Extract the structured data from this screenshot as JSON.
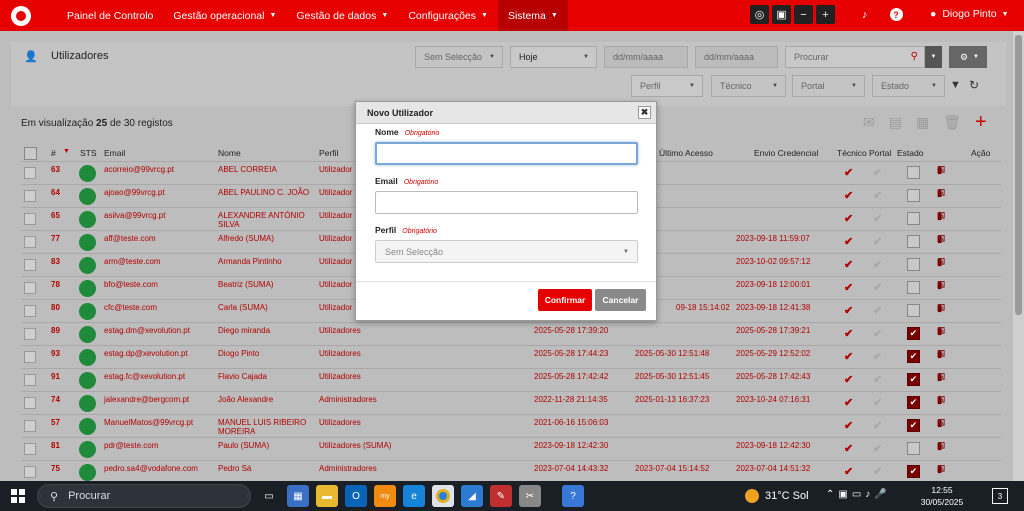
{
  "nav": {
    "items": [
      {
        "label": "Painel de Controlo",
        "caret": false,
        "active": false
      },
      {
        "label": "Gestão operacional",
        "caret": true,
        "active": false
      },
      {
        "label": "Gestão de dados",
        "caret": true,
        "active": false
      },
      {
        "label": "Configurações",
        "caret": true,
        "active": false
      },
      {
        "label": "Sistema",
        "caret": true,
        "active": true
      }
    ],
    "user": "Diogo Pinto",
    "tools": [
      "chat-icon",
      "contact-card-icon",
      "minus-icon",
      "plus-icon"
    ],
    "brand_color": "#e60000"
  },
  "header": {
    "title": "Utilizadores",
    "filters": {
      "selection": "Sem Selecção",
      "period": "Hoje",
      "date_from_placeholder": "dd/mm/aaaa",
      "date_to_placeholder": "dd/mm/aaaa",
      "search_placeholder": "Procurar",
      "profile": "Perfil",
      "technician": "Técnico",
      "portal": "Portal",
      "state": "Estado"
    }
  },
  "content": {
    "counter_prefix": "Em visualização",
    "counter_count": "25",
    "counter_suffix": "de 30 registos",
    "columns": {
      "num": "#",
      "sts": "STS",
      "email": "Email",
      "name": "Nome",
      "profile": "Perfil",
      "last_access": "Último Acesso",
      "credential": "Envio Credencial",
      "technician": "Técnico",
      "portal": "Portal",
      "state": "Estado",
      "action": "Ação"
    },
    "rows": [
      {
        "id": "63",
        "email": "acorreio@99vrcg.pt",
        "name": "ABEL CORREIA",
        "profile": "Utilizador",
        "created": "",
        "last": "",
        "cred": "",
        "tech": true,
        "portal": false,
        "state": false
      },
      {
        "id": "64",
        "email": "ajoao@99vrcg.pt",
        "name": "ABEL PAULINO C. JOÃO",
        "profile": "Utilizador",
        "created": "",
        "last": "",
        "cred": "",
        "tech": true,
        "portal": false,
        "state": false
      },
      {
        "id": "65",
        "email": "asilva@99vrcg.pt",
        "name": "ALEXANDRE ANTÓNIO",
        "name2": "SILVA",
        "profile": "Utilizador",
        "created": "",
        "last": "",
        "cred": "",
        "tech": true,
        "portal": false,
        "state": false
      },
      {
        "id": "77",
        "email": "aff@teste.com",
        "name": "Alfredo (SUMA)",
        "profile": "Utilizador",
        "created": "",
        "last": "",
        "cred": "2023-09-18 11:59:07",
        "tech": true,
        "portal": false,
        "state": false
      },
      {
        "id": "83",
        "email": "arm@teste.com",
        "name": "Armanda Pintinho",
        "profile": "Utilizador",
        "created": "",
        "last": "",
        "cred": "2023-10-02 09:57:12",
        "tech": true,
        "portal": false,
        "state": false
      },
      {
        "id": "78",
        "email": "bfo@teste.com",
        "name": "Beatriz (SUMA)",
        "profile": "Utilizador",
        "created": "",
        "last": "",
        "cred": "2023-09-18 12:00:01",
        "tech": true,
        "portal": false,
        "state": false
      },
      {
        "id": "80",
        "email": "cfc@teste.com",
        "name": "Carla (SUMA)",
        "profile": "Utilizador",
        "created": "",
        "last": "09-18 15:14:02",
        "cred": "2023-09-18 12:41:38",
        "tech": true,
        "portal": false,
        "state": false
      },
      {
        "id": "89",
        "email": "estag.dm@xevolution.pt",
        "name": "Diego miranda",
        "profile": "Utilizadores",
        "created": "2025-05-28 17:39:20",
        "last": "",
        "cred": "2025-05-28 17:39:21",
        "tech": true,
        "portal": false,
        "state": true
      },
      {
        "id": "93",
        "email": "estag.dp@xevolution.pt",
        "name": "Diogo Pinto",
        "profile": "Utilizadores",
        "created": "2025-05-28 17:44:23",
        "last": "2025-05-30 12:51:48",
        "cred": "2025-05-29 12:52:02",
        "tech": true,
        "portal": false,
        "state": true
      },
      {
        "id": "91",
        "email": "estag.fc@xevolution.pt",
        "name": "Flavio Cajada",
        "profile": "Utilizadores",
        "created": "2025-05-28 17:42:42",
        "last": "2025-05-30 12:51:45",
        "cred": "2025-05-28 17:42:43",
        "tech": true,
        "portal": false,
        "state": true
      },
      {
        "id": "74",
        "email": "jalexandre@bergcom.pt",
        "name": "João Alexandre",
        "profile": "Administradores",
        "created": "2022-11-28 21:14:35",
        "last": "2025-01-13 16:37:23",
        "cred": "2023-10-24 07:16:31",
        "tech": true,
        "portal": false,
        "state": true
      },
      {
        "id": "57",
        "email": "ManuelMatos@99vrcg.pt",
        "name": "MANUEL LUIS RIBEIRO",
        "name2": "MOREIRA",
        "profile": "Utilizadores",
        "created": "2021-06-16 15:06:03",
        "last": "",
        "cred": "",
        "tech": true,
        "portal": false,
        "state": true
      },
      {
        "id": "81",
        "email": "pdr@teste.com",
        "name": "Paulo (SUMA)",
        "profile": "Utilizadores (SUMA)",
        "created": "2023-09-18 12:42:30",
        "last": "",
        "cred": "2023-09-18 12:42:30",
        "tech": true,
        "portal": false,
        "state": false
      },
      {
        "id": "75",
        "email": "pedro.sa4@vodafone.com",
        "name": "Pedro Sá",
        "profile": "Administradores",
        "created": "2023-07-04 14:43:32",
        "last": "2023-07-04 15:14:52",
        "cred": "2023-07-04 14:51:32",
        "tech": true,
        "portal": false,
        "state": true
      }
    ]
  },
  "modal": {
    "title": "Novo Utilizador",
    "name_label": "Nome",
    "email_label": "Email",
    "profile_label": "Perfil",
    "required": "Obrigatório",
    "profile_placeholder": "Sem Selecção",
    "confirm": "Confirmar",
    "cancel": "Cancelar"
  },
  "taskbar": {
    "search": "Procurar",
    "weather": "31°C  Sol",
    "time": "12:55",
    "date": "30/05/2025",
    "notifications": "3"
  }
}
